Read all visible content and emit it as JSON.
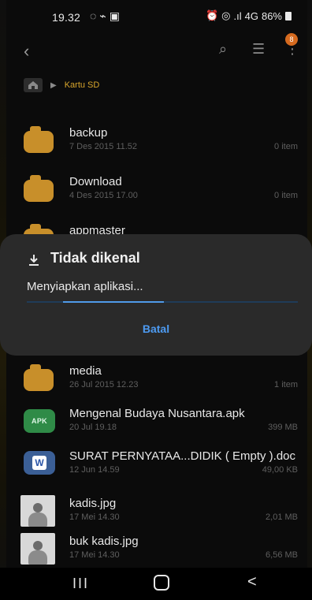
{
  "status": {
    "time": "19.32",
    "left_icons": [
      "whatsapp-icon",
      "messenger-icon",
      "gallery-icon"
    ],
    "right_text_signal": ".ıl",
    "right_text_net": "4G",
    "battery_text": "86%"
  },
  "topbar": {
    "badge": "8"
  },
  "breadcrumb": {
    "path": "Kartu SD"
  },
  "items": [
    {
      "title": "backup",
      "date": "7 Des 2015 11.52",
      "size": "0 item",
      "type": "folder"
    },
    {
      "title": "Download",
      "date": "4 Des 2015 17.00",
      "size": "0 item",
      "type": "folder"
    },
    {
      "title": "appmaster",
      "date": "",
      "size": "",
      "type": "folder"
    },
    {
      "title": "media",
      "date": "26 Jul 2015 12.23",
      "size": "1 item",
      "type": "folder"
    },
    {
      "title": "Mengenal Budaya Nusantara.apk",
      "date": "20 Jul 19.18",
      "size": "399 MB",
      "type": "apk",
      "badge": "APK"
    },
    {
      "title": "SURAT PERNYATAA...DIDIK ( Empty ).doc",
      "date": "12 Jun 14.59",
      "size": "49,00 KB",
      "type": "doc",
      "badge": "W"
    },
    {
      "title": "kadis.jpg",
      "date": "17 Mei 14.30",
      "size": "2,01 MB",
      "type": "image"
    },
    {
      "title": "buk kadis.jpg",
      "date": "17 Mei 14.30",
      "size": "6,56 MB",
      "type": "image"
    }
  ],
  "dialog": {
    "title": "Tidak dikenal",
    "message": "Menyiapkan aplikasi...",
    "button": "Batal",
    "progress": 0.37
  },
  "nav": {
    "recents": "III",
    "back": "<"
  }
}
